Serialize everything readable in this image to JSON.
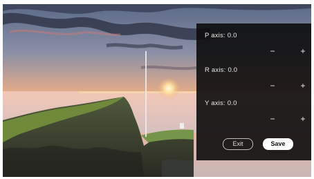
{
  "axes": [
    {
      "label": "P axis:",
      "value": "0.0",
      "decrease": "−",
      "increase": "+"
    },
    {
      "label": "R axis:",
      "value": "0.0",
      "decrease": "−",
      "increase": "+"
    },
    {
      "label": "Y axis:",
      "value": "0.0",
      "decrease": "−",
      "increase": "+"
    }
  ],
  "buttons": {
    "exit": "Exit",
    "save": "Save"
  },
  "colors": {
    "panel": "#0c0c0c",
    "save_bg": "#ffffff",
    "text": "#e9e9e9"
  }
}
